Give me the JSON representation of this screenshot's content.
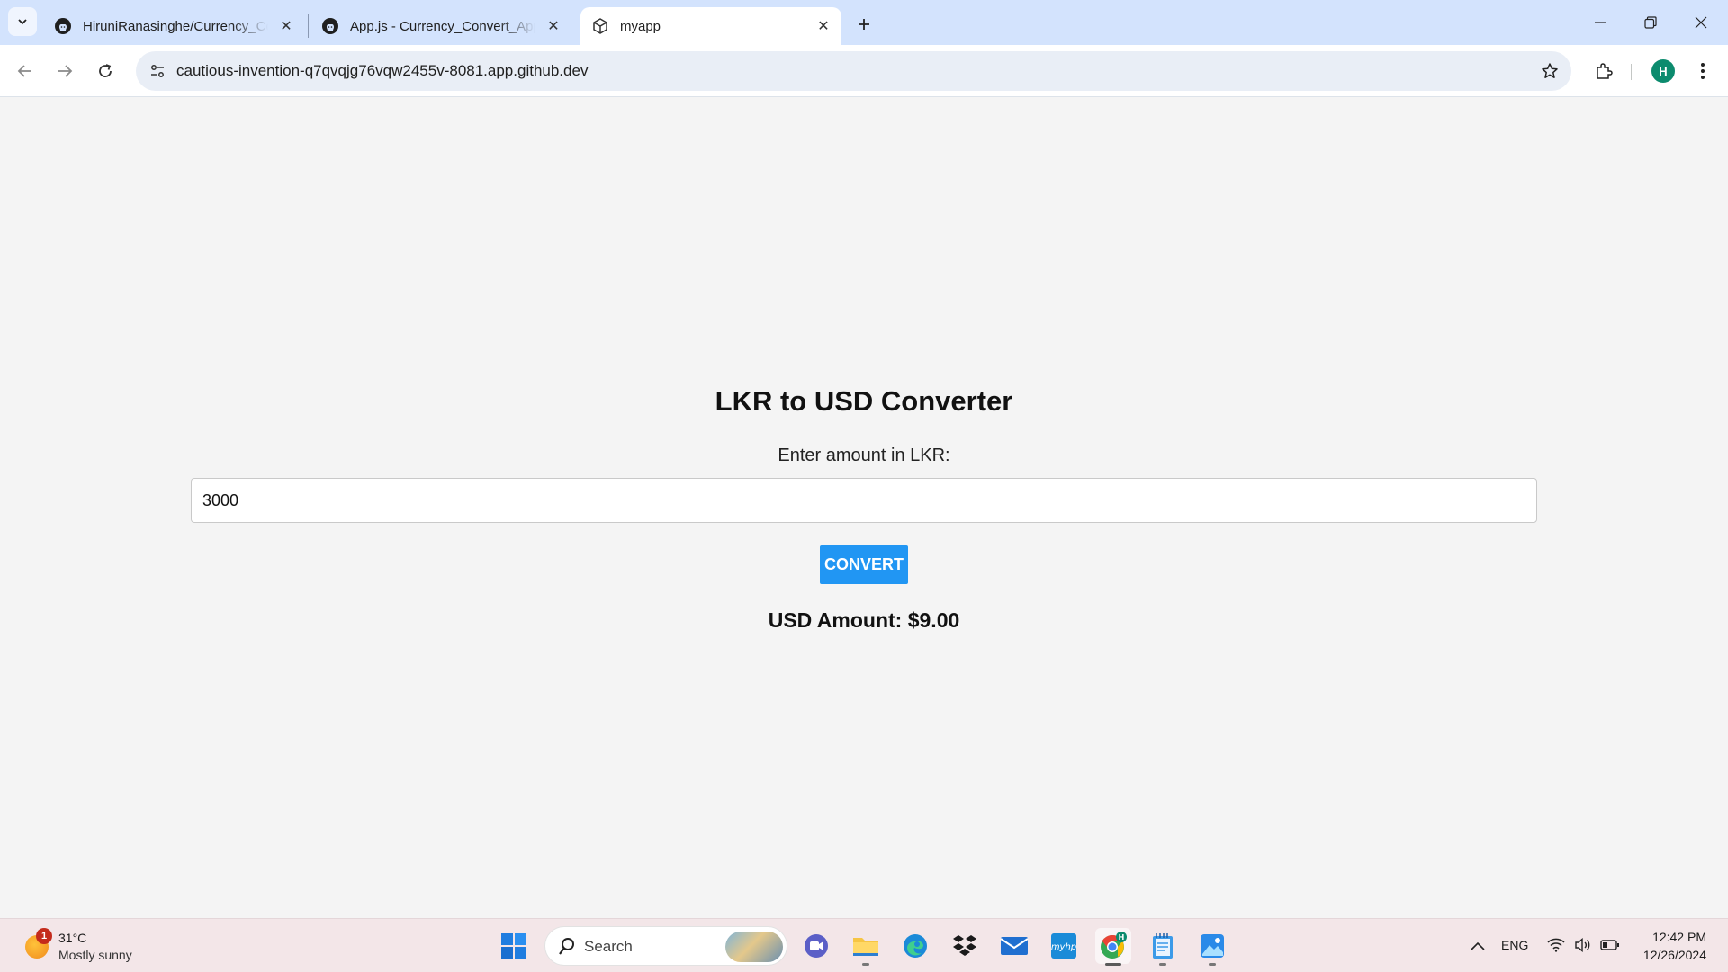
{
  "browser": {
    "tabs": [
      {
        "title": "HiruniRanasinghe/Currency_Co",
        "favicon": "github-icon"
      },
      {
        "title": "App.js - Currency_Convert_App",
        "favicon": "github-icon"
      },
      {
        "title": "myapp",
        "favicon": "cube-icon",
        "active": true
      }
    ],
    "address": "cautious-invention-q7qvqjg76vqw2455v-8081.app.github.dev",
    "profile_initial": "H"
  },
  "app": {
    "title": "LKR to USD Converter",
    "input_label": "Enter amount in LKR:",
    "input_value": "3000",
    "convert_label": "CONVERT",
    "result": "USD Amount: $9.00",
    "accent_color": "#2196f3"
  },
  "taskbar": {
    "weather": {
      "badge": "1",
      "temp": "31°C",
      "condition": "Mostly sunny"
    },
    "search_placeholder": "Search",
    "language": "ENG",
    "time": "12:42 PM",
    "date": "12/26/2024"
  }
}
